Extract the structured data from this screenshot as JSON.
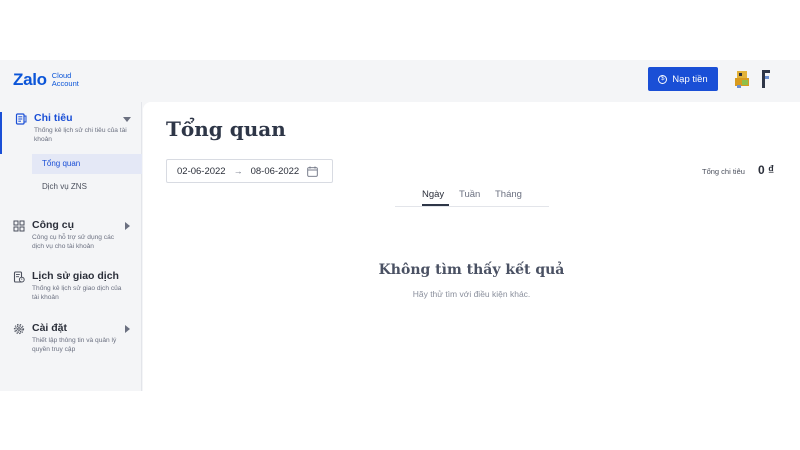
{
  "header": {
    "logo_main": "Zalo",
    "logo_sub_line1": "Cloud",
    "logo_sub_line2": "Account",
    "topup_label": "Nạp tiền",
    "accent_color": "#1a4fd6"
  },
  "sidebar": {
    "groups": [
      {
        "title": "Chi tiêu",
        "desc": "Thống kê lịch sử chi tiêu của tài khoản",
        "icon": "receipt-icon",
        "caret": "caret-down-icon"
      },
      {
        "title": "Công cụ",
        "desc": "Công cụ hỗ trợ sử dụng các dịch vụ cho tài khoản",
        "icon": "grid-icon",
        "caret": "caret-right-icon"
      },
      {
        "title": "Lịch sử giao dịch",
        "desc": "Thống kê lịch sử giao dịch của tài khoản",
        "icon": "history-icon"
      },
      {
        "title": "Cài đặt",
        "desc": "Thiết lập thông tin và quản lý quyền truy cập",
        "icon": "gear-icon",
        "caret": "caret-right-icon"
      }
    ],
    "sub_items": [
      {
        "label": "Tổng quan",
        "selected": true
      },
      {
        "label": "Dịch vụ ZNS",
        "selected": false
      }
    ]
  },
  "main": {
    "title": "Tổng quan",
    "date_start": "02-06-2022",
    "date_arrow": "→",
    "date_end": "08-06-2022",
    "total_label": "Tổng chi tiêu",
    "total_value": "0 ₫",
    "tabs": [
      {
        "label": "Ngày",
        "active": true
      },
      {
        "label": "Tuần",
        "active": false
      },
      {
        "label": "Tháng",
        "active": false
      }
    ],
    "empty_title": "Không tìm thấy kết quả",
    "empty_subtitle": "Hãy thử tìm với điều kiện khác."
  }
}
